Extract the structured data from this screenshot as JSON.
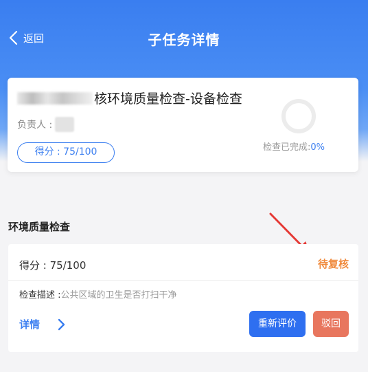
{
  "header": {
    "back_label": "返回",
    "title": "子任务详情"
  },
  "summary": {
    "task_title": "核环境质量检查-设备检查",
    "owner_label": "负责人 :",
    "score_label": "得分 : 75/100",
    "progress_label": "检查已完成:",
    "progress_value": "0%",
    "progress_fraction": 0
  },
  "section": {
    "title": "环境质量检查"
  },
  "item": {
    "score": "得分 : 75/100",
    "status": "待复核",
    "desc_label": "检查描述 :",
    "desc_value": "公共区域的卫生是否打扫干净",
    "detail_label": "详情",
    "reeval_label": "重新评价",
    "reject_label": "驳回"
  },
  "colors": {
    "primary": "#3a7ef0",
    "status": "#f08a3c",
    "reject": "#e8765e",
    "annotation_arrow": "#e53935"
  }
}
